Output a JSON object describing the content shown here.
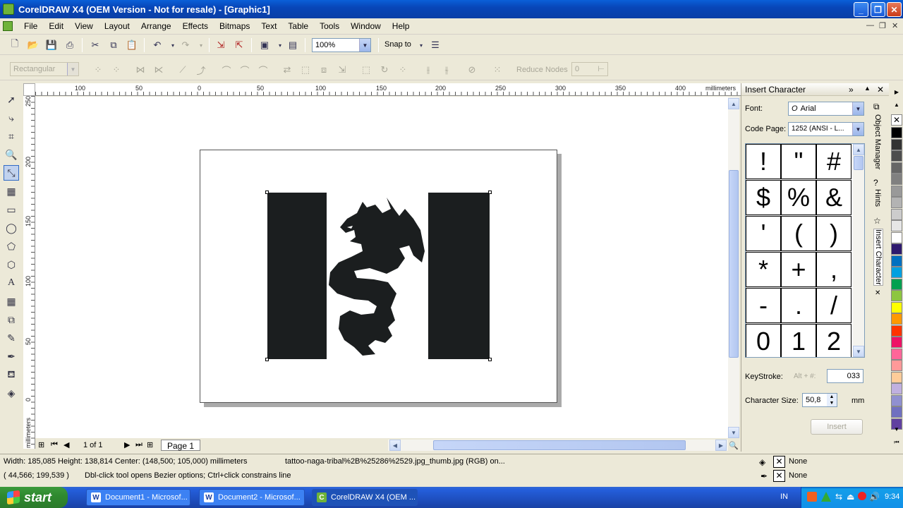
{
  "window": {
    "title": "CorelDRAW X4 (OEM Version - Not for resale) - [Graphic1]"
  },
  "menu": [
    "File",
    "Edit",
    "View",
    "Layout",
    "Arrange",
    "Effects",
    "Bitmaps",
    "Text",
    "Table",
    "Tools",
    "Window",
    "Help"
  ],
  "standard_toolbar": {
    "zoom_value": "100%",
    "snap_label": "Snap to"
  },
  "property_bar": {
    "mode_value": "Rectangular",
    "reduce_nodes_label": "Reduce Nodes",
    "reduce_nodes_value": "0"
  },
  "ruler": {
    "h_labels": [
      "100",
      "50",
      "0",
      "50",
      "100",
      "150",
      "200",
      "250",
      "300",
      "350",
      "400"
    ],
    "h_unit": "millimeters",
    "v_labels": [
      "250",
      "200",
      "150",
      "100",
      "50",
      "0"
    ],
    "v_unit": "millimeters"
  },
  "page_nav": {
    "counter": "1 of 1",
    "tab": "Page 1"
  },
  "docker": {
    "title": "Insert Character",
    "font_label": "Font:",
    "font_value": "Arial",
    "codepage_label": "Code Page:",
    "codepage_value": "1252  (ANSI - L...",
    "chars": [
      "!",
      "\"",
      "#",
      "$",
      "%",
      "&",
      "'",
      "(",
      ")",
      "*",
      "+",
      ",",
      "-",
      ".",
      "/",
      "0",
      "1",
      "2"
    ],
    "keystroke_label": "KeyStroke:",
    "alt_label": "Alt + #:",
    "keystroke_value": "033",
    "charsize_label": "Character Size:",
    "charsize_value": "50,8",
    "charsize_unit": "mm",
    "insert_label": "Insert",
    "side_tabs": [
      "Object Manager",
      "Hints",
      "Insert Character"
    ]
  },
  "palette": [
    "#000000",
    "#333333",
    "#4d4d4d",
    "#666666",
    "#808080",
    "#999999",
    "#b3b3b3",
    "#cccccc",
    "#e6e6e6",
    "#ffffff",
    "#2e1a6e",
    "#0070c0",
    "#00a0e0",
    "#00a050",
    "#8dc63f",
    "#ffff00",
    "#ff9900",
    "#ff3300",
    "#ee1166",
    "#ff6699",
    "#ff9999",
    "#ffcc99",
    "#c0b0e0",
    "#9090d0",
    "#7070c0",
    "#6040a0"
  ],
  "status": {
    "line1": "Width: 185,085  Height: 138,814  Center: (148,500; 105,000)  millimeters",
    "file_info": "tattoo-naga-tribal%2B%25286%2529.jpg_thumb.jpg (RGB) on...",
    "line2": "( 44,566; 199,539 )",
    "hint": "Dbl-click tool opens Bezier options; Ctrl+click constrains line",
    "fill_label": "None",
    "outline_label": "None"
  },
  "taskbar": {
    "start_label": "start",
    "tasks": [
      "Document1 - Microsof...",
      "Document2 - Microsof...",
      "CorelDRAW X4 (OEM ..."
    ],
    "lang": "IN",
    "clock": "9:34"
  }
}
